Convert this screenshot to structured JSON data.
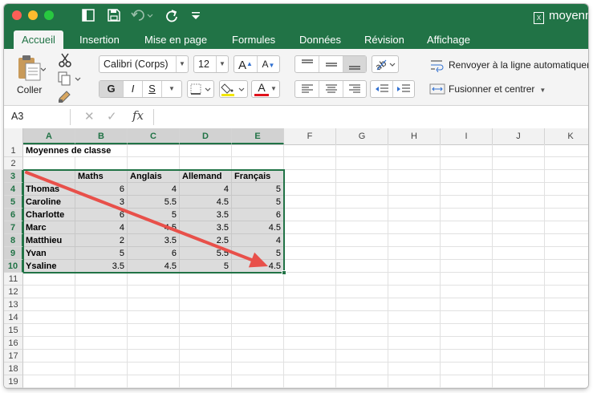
{
  "window": {
    "title": "moyenne",
    "file_badge": "X",
    "accent": "#217346"
  },
  "tabs": [
    {
      "label": "Accueil",
      "active": true
    },
    {
      "label": "Insertion"
    },
    {
      "label": "Mise en page"
    },
    {
      "label": "Formules"
    },
    {
      "label": "Données"
    },
    {
      "label": "Révision"
    },
    {
      "label": "Affichage"
    }
  ],
  "ribbon": {
    "paste_label": "Coller",
    "font_name": "Calibri (Corps)",
    "font_size": "12",
    "grow_font": "A",
    "shrink_font": "A",
    "bold": "G",
    "italic": "I",
    "underline": "S",
    "font_color_glyph": "A",
    "highlight_color": "#f2e600",
    "font_color": "#e0121c",
    "wrap_text": "Renvoyer à la ligne automatiquement",
    "merge_center": "Fusionner et centrer"
  },
  "formula_bar": {
    "name_box": "A3",
    "fx": "fx",
    "content": ""
  },
  "sheet": {
    "columns": [
      "A",
      "B",
      "C",
      "D",
      "E",
      "F",
      "G",
      "H",
      "I",
      "J",
      "K"
    ],
    "rows": [
      "1",
      "2",
      "3",
      "4",
      "5",
      "6",
      "7",
      "8",
      "9",
      "10",
      "11",
      "12",
      "13",
      "14",
      "15",
      "16",
      "17",
      "18",
      "19"
    ],
    "title_cell": "Moyennes de classe",
    "headers": [
      "",
      "Maths",
      "Anglais",
      "Allemand",
      "Français"
    ],
    "data": [
      [
        "Thomas",
        "6",
        "4",
        "4",
        "5"
      ],
      [
        "Caroline",
        "3",
        "5.5",
        "4.5",
        "5"
      ],
      [
        "Charlotte",
        "6",
        "5",
        "3.5",
        "6"
      ],
      [
        "Marc",
        "4",
        "4.5",
        "3.5",
        "4.5"
      ],
      [
        "Matthieu",
        "2",
        "3.5",
        "2.5",
        "4"
      ],
      [
        "Yvan",
        "5",
        "6",
        "5.5",
        "5"
      ],
      [
        "Ysaline",
        "3.5",
        "4.5",
        "5",
        "4.5"
      ]
    ],
    "selection": "A3:E10",
    "arrow_color": "#e8504a"
  }
}
